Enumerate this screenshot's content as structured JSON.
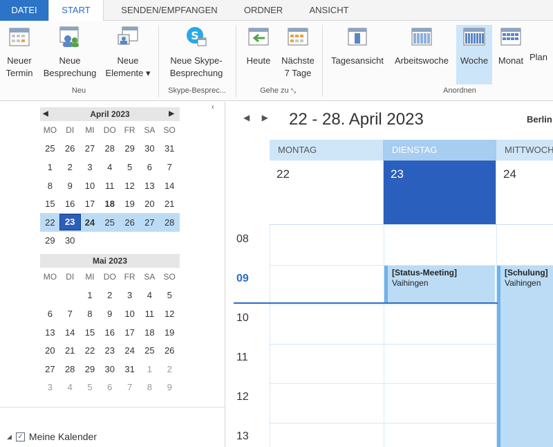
{
  "ribbon_tabs": [
    "DATEI",
    "START",
    "SENDEN/EMPFANGEN",
    "ORDNER",
    "ANSICHT"
  ],
  "ribbon": {
    "new_appointment": "Neuer\nTermin",
    "new_meeting": "Neue\nBesprechung",
    "new_items": "Neue\nElemente ▾",
    "group_new": "Neu",
    "new_skype": "Neue Skype-\nBesprechung",
    "group_skype": "Skype-Besprec...",
    "today": "Heute",
    "next7": "Nächste\n7 Tage",
    "group_goto": "Gehe zu",
    "day_view": "Tagesansicht",
    "work_week": "Arbeitswoche",
    "week": "Woche",
    "month": "Monat",
    "plan": "Plan",
    "group_arrange": "Anordnen"
  },
  "minical": {
    "april": {
      "title": "April 2023",
      "dow": [
        "MO",
        "DI",
        "MI",
        "DO",
        "FR",
        "SA",
        "SO"
      ],
      "weeks": [
        [
          "25",
          "26",
          "27",
          "28",
          "29",
          "30",
          "31"
        ],
        [
          "1",
          "2",
          "3",
          "4",
          "5",
          "6",
          "7"
        ],
        [
          "8",
          "9",
          "10",
          "11",
          "12",
          "13",
          "14"
        ],
        [
          "15",
          "16",
          "17",
          "18",
          "19",
          "20",
          "21"
        ],
        [
          "22",
          "23",
          "24",
          "25",
          "26",
          "27",
          "28"
        ],
        [
          "29",
          "30",
          "",
          "",
          "",
          "",
          ""
        ]
      ]
    },
    "may": {
      "title": "Mai 2023",
      "dow": [
        "MO",
        "DI",
        "MI",
        "DO",
        "FR",
        "SA",
        "SO"
      ],
      "weeks": [
        [
          "",
          "",
          "1",
          "2",
          "3",
          "4",
          "5"
        ],
        [
          "6",
          "7",
          "8",
          "9",
          "10",
          "11",
          "12"
        ],
        [
          "13",
          "14",
          "15",
          "16",
          "17",
          "18",
          "19"
        ],
        [
          "20",
          "21",
          "22",
          "23",
          "24",
          "25",
          "26"
        ],
        [
          "27",
          "28",
          "29",
          "30",
          "31",
          "1",
          "2"
        ],
        [
          "3",
          "4",
          "5",
          "6",
          "7",
          "8",
          "9"
        ]
      ]
    }
  },
  "my_calendars": "Meine Kalender",
  "main": {
    "range_title": "22 - 28. April 2023",
    "location": "Berlin",
    "days": [
      {
        "name": "MONTAG",
        "date": "22"
      },
      {
        "name": "DIENSTAG",
        "date": "23"
      },
      {
        "name": "MITTWOCH",
        "date": "24"
      }
    ],
    "hours": [
      "08",
      "09",
      "10",
      "11",
      "12",
      "13"
    ],
    "events": [
      {
        "title": "[Status-Meeting]",
        "location": "Vaihingen"
      },
      {
        "title": "[Schulung]",
        "location": "Vaihingen"
      }
    ]
  },
  "colors": {
    "accent": "#2b6cc4",
    "selected_day": "#2b5fbd",
    "event_fill": "#bcdcf5"
  }
}
